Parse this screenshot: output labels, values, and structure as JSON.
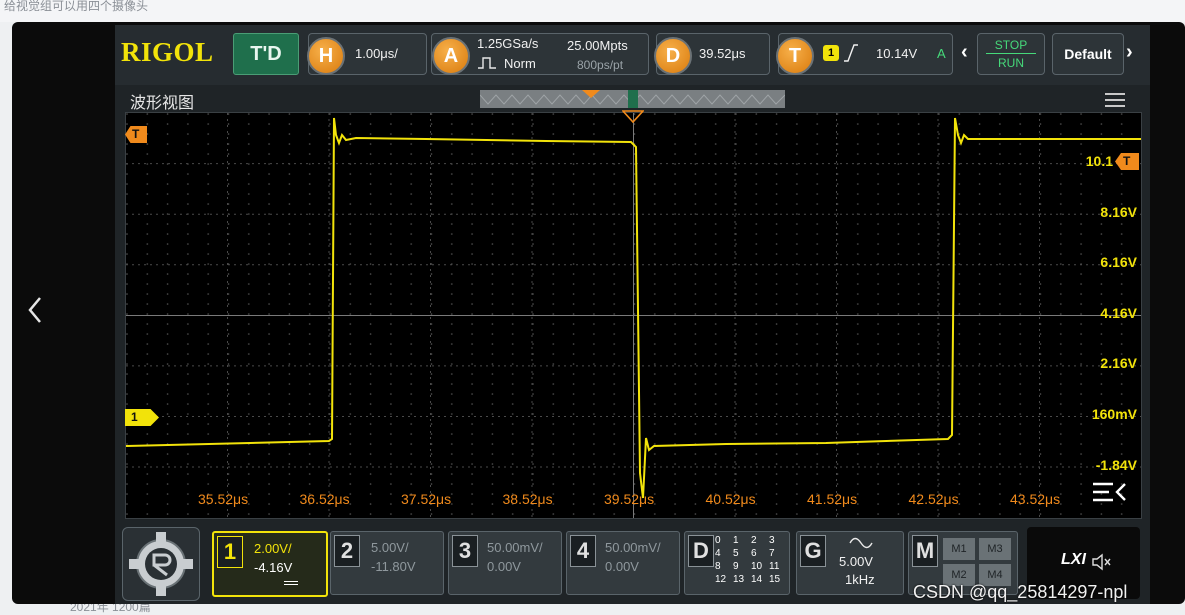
{
  "background": {
    "top_text": "给视觉组可以用四个摄像头",
    "bottom_text": "2021年 1200篇"
  },
  "nav": {
    "prev_icon": "chevron-left-icon"
  },
  "scope": {
    "logo": "RIGOL",
    "td_label": "T'D",
    "horizontal": {
      "key": "H",
      "value": "1.00μs/"
    },
    "acquire": {
      "key": "A",
      "sample_rate": "1.25GSa/s",
      "mode": "Norm",
      "memory": "25.00Mpts",
      "resolution": "800ps/pt"
    },
    "delay": {
      "key": "D",
      "value": "39.52μs"
    },
    "trigger": {
      "key": "T",
      "source": "1",
      "level": "10.14V",
      "status": "A"
    },
    "run_control": {
      "stop": "STOP",
      "run": "RUN"
    },
    "default_label": "Default",
    "window_title": "波形视图",
    "y_axis_labels": [
      "10.1",
      "8.16V",
      "6.16V",
      "4.16V",
      "2.16V",
      "160mV",
      "-1.84V"
    ],
    "x_axis_labels": [
      "35.52μs",
      "36.52μs",
      "37.52μs",
      "38.52μs",
      "39.52μs",
      "40.52μs",
      "41.52μs",
      "42.52μs",
      "43.52μs"
    ],
    "markers": {
      "trigger": "T",
      "channel": "1"
    },
    "channels": [
      {
        "num": "1",
        "scale": "2.00V/",
        "offset": "-4.16V"
      },
      {
        "num": "2",
        "scale": "5.00V/",
        "offset": "-11.80V"
      },
      {
        "num": "3",
        "scale": "50.00mV/",
        "offset": "0.00V"
      },
      {
        "num": "4",
        "scale": "50.00mV/",
        "offset": "0.00V"
      }
    ],
    "digital": {
      "key": "D",
      "rows": [
        [
          "0",
          "1",
          "2",
          "3"
        ],
        [
          "4",
          "5",
          "6",
          "7"
        ],
        [
          "8",
          "9",
          "10",
          "11"
        ],
        [
          "12",
          "13",
          "14",
          "15"
        ]
      ]
    },
    "generator": {
      "key": "G",
      "amplitude": "5.00V",
      "frequency": "1kHz"
    },
    "math": {
      "key": "M",
      "buttons": [
        "M1",
        "M3",
        "M2",
        "M4"
      ]
    },
    "lxi_label": "LXI",
    "colors": {
      "ch1": "#f2e30a",
      "orange": "#f08a1c",
      "panel": "#1f2427"
    }
  },
  "watermark": "CSDN @qq_25814297-npl"
}
